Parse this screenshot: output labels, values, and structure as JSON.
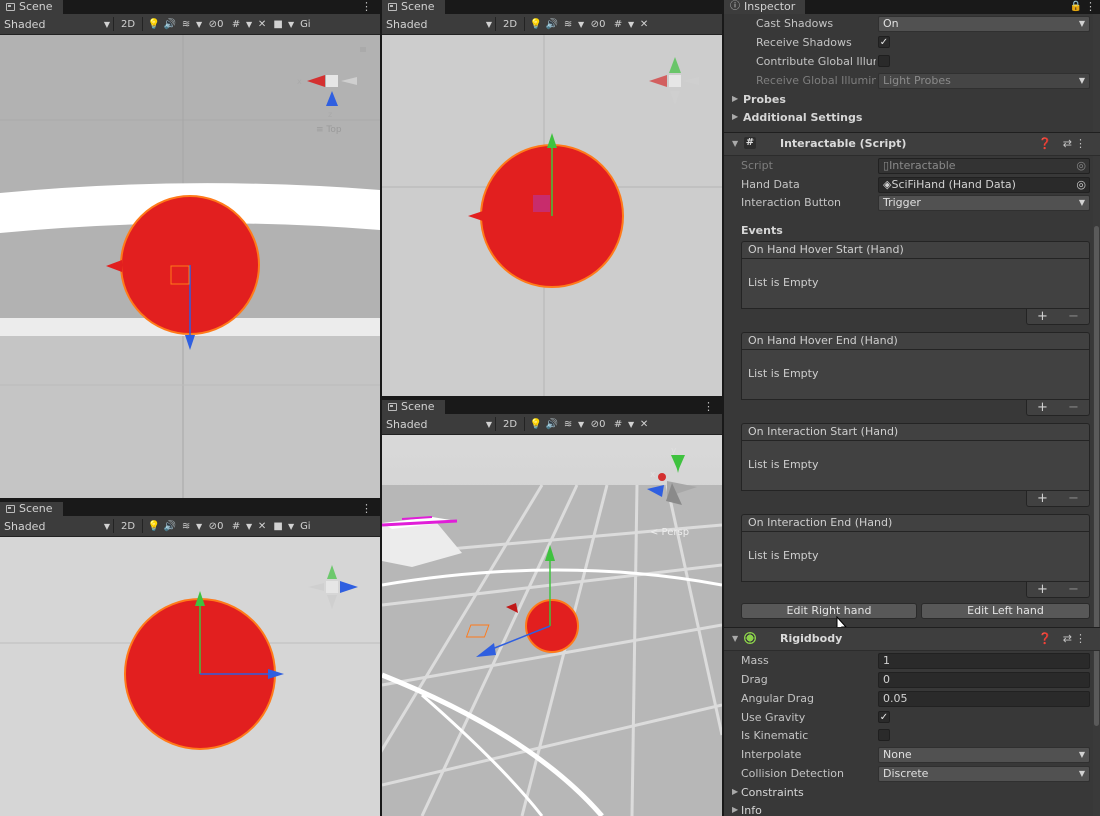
{
  "scene_views": [
    {
      "tab": "Scene",
      "shading": "Shaded",
      "mode2d": "2D",
      "hidden_count": "0",
      "gizmos_label": "Gi"
    },
    {
      "tab": "Scene",
      "shading": "Shaded",
      "mode2d": "2D",
      "hidden_count": "0"
    },
    {
      "tab": "Scene",
      "shading": "Shaded",
      "mode2d": "2D",
      "hidden_count": "0",
      "gizmos_label": "Gi"
    },
    {
      "tab": "Scene",
      "shading": "Shaded",
      "mode2d": "2D",
      "hidden_count": "0",
      "axis_x": "x",
      "axis_y": "y",
      "persp_label": "< Persp"
    }
  ],
  "scene_gizmo_labels": {
    "top_left_view": "Top",
    "axis_x": "x",
    "axis_z": "z"
  },
  "inspector": {
    "tab": "Inspector",
    "mesh_renderer": {
      "cast_shadows_label": "Cast Shadows",
      "cast_shadows_value": "On",
      "receive_shadows_label": "Receive Shadows",
      "receive_shadows_checked": "✓",
      "contribute_gi_label": "Contribute Global Illum",
      "receive_gi_label": "Receive Global Illumin",
      "receive_gi_value": "Light Probes",
      "probes_label": "Probes",
      "additional_settings_label": "Additional Settings"
    },
    "interactable": {
      "title": "Interactable (Script)",
      "script_label": "Script",
      "script_value": "Interactable",
      "hand_data_label": "Hand Data",
      "hand_data_value": "SciFiHand (Hand Data)",
      "interaction_button_label": "Interaction Button",
      "interaction_button_value": "Trigger",
      "events_label": "Events",
      "events": [
        {
          "name": "On Hand Hover Start (Hand)",
          "body": "List is Empty"
        },
        {
          "name": "On Hand Hover End (Hand)",
          "body": "List is Empty"
        },
        {
          "name": "On Interaction Start (Hand)",
          "body": "List is Empty"
        },
        {
          "name": "On Interaction End (Hand)",
          "body": "List is Empty"
        }
      ],
      "edit_right": "Edit Right hand",
      "edit_left": "Edit Left hand"
    },
    "rigidbody": {
      "title": "Rigidbody",
      "mass_label": "Mass",
      "mass_value": "1",
      "drag_label": "Drag",
      "drag_value": "0",
      "angular_drag_label": "Angular Drag",
      "angular_drag_value": "0.05",
      "use_gravity_label": "Use Gravity",
      "use_gravity_checked": "✓",
      "is_kinematic_label": "Is Kinematic",
      "interpolate_label": "Interpolate",
      "interpolate_value": "None",
      "collision_label": "Collision Detection",
      "collision_value": "Discrete",
      "constraints_label": "Constraints",
      "info_label": "Info"
    }
  },
  "colors": {
    "sphere": "#e02020",
    "sphere_outline": "#ff7a1a",
    "axis_x": "#d43030",
    "axis_y": "#3fc23f",
    "axis_z": "#2f5fe0"
  }
}
